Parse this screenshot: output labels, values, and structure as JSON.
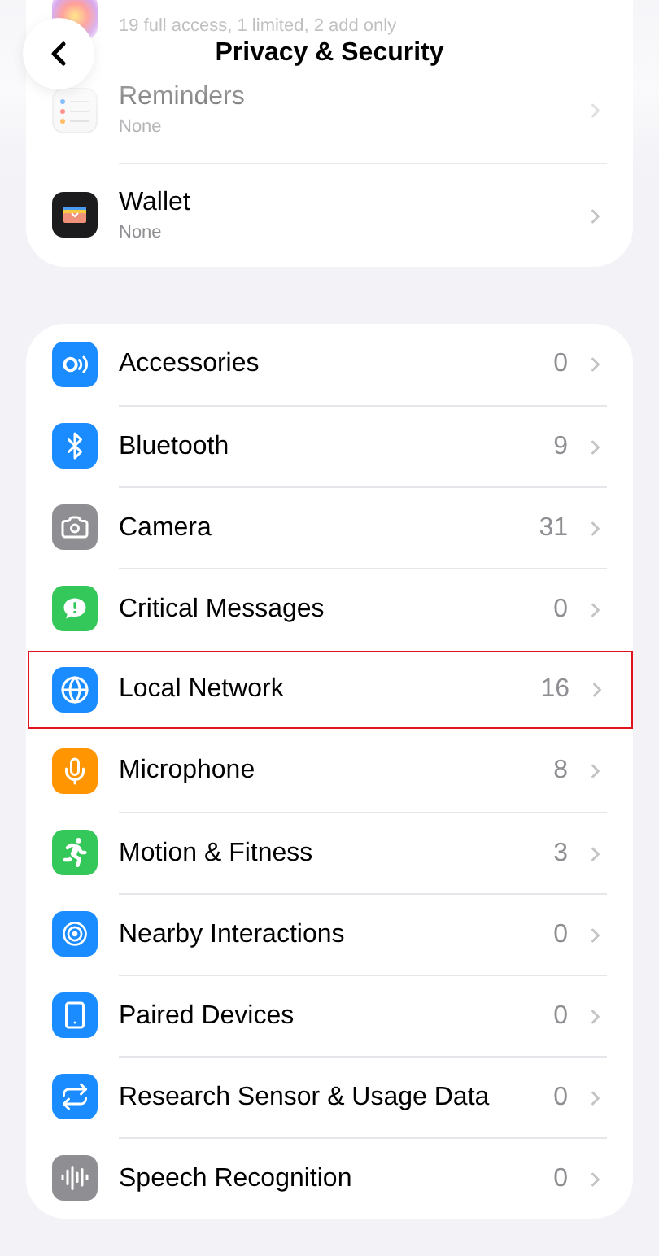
{
  "header": {
    "title": "Privacy & Security"
  },
  "apps_above": {
    "subtitle": "19 full access, 1 limited, 2 add only"
  },
  "apps": [
    {
      "name": "Reminders",
      "subtitle": "None"
    },
    {
      "name": "Wallet",
      "subtitle": "None"
    }
  ],
  "permissions": [
    {
      "name": "Accessories",
      "count": "0",
      "highlighted": false
    },
    {
      "name": "Bluetooth",
      "count": "9",
      "highlighted": false
    },
    {
      "name": "Camera",
      "count": "31",
      "highlighted": false
    },
    {
      "name": "Critical Messages",
      "count": "0",
      "highlighted": false
    },
    {
      "name": "Local Network",
      "count": "16",
      "highlighted": true
    },
    {
      "name": "Microphone",
      "count": "8",
      "highlighted": false
    },
    {
      "name": "Motion & Fitness",
      "count": "3",
      "highlighted": false
    },
    {
      "name": "Nearby Interactions",
      "count": "0",
      "highlighted": false
    },
    {
      "name": "Paired Devices",
      "count": "0",
      "highlighted": false
    },
    {
      "name": "Research Sensor & Usage Data",
      "count": "0",
      "highlighted": false
    },
    {
      "name": "Speech Recognition",
      "count": "0",
      "highlighted": false
    }
  ]
}
